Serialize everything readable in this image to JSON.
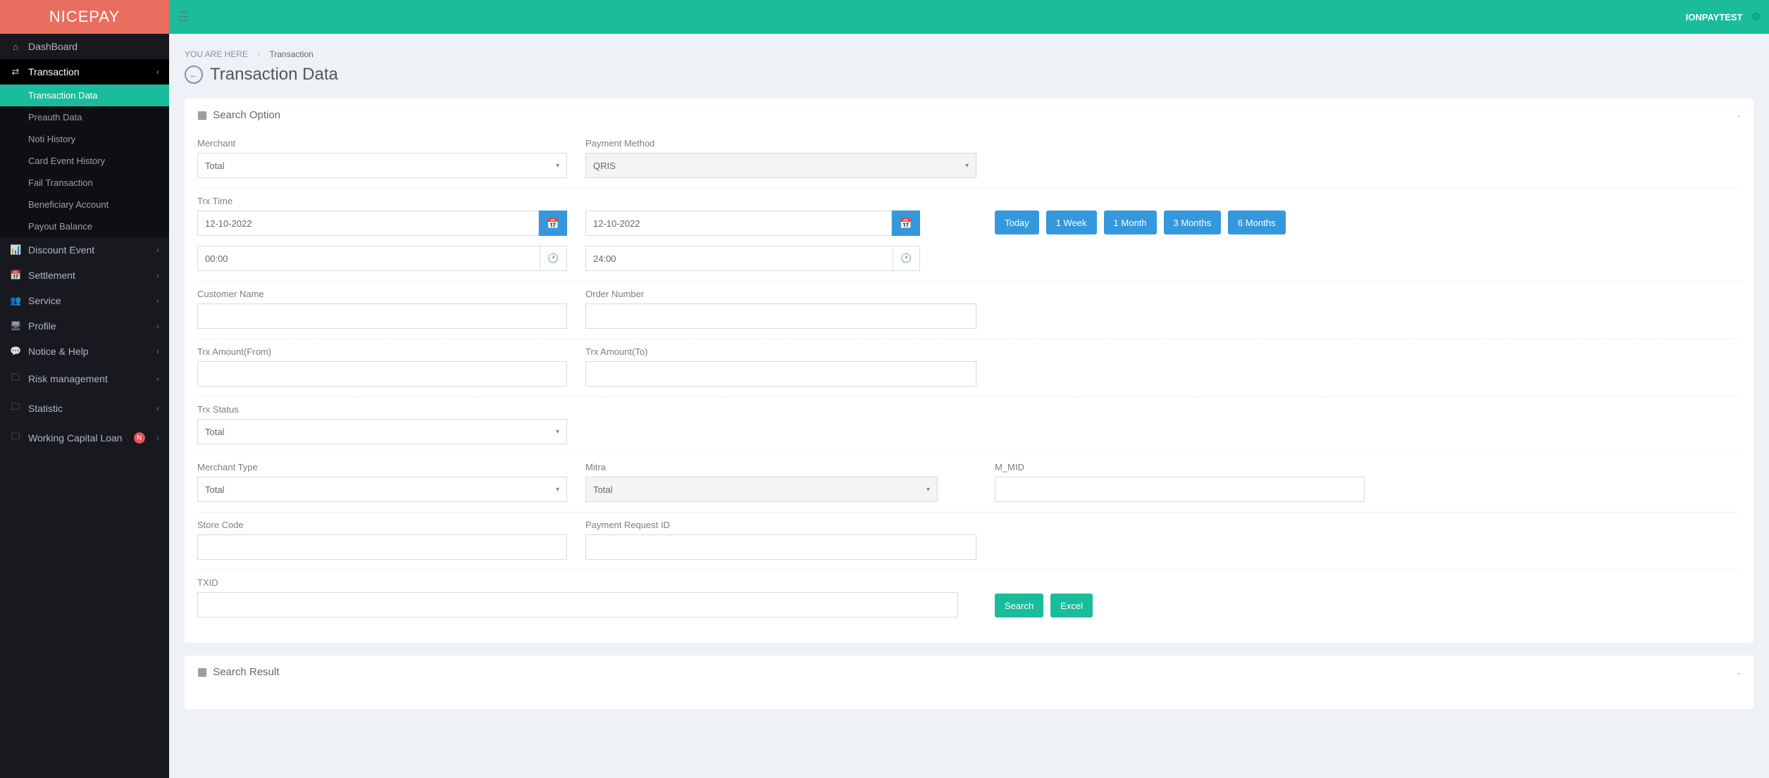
{
  "header": {
    "brand": "NICEPAY",
    "username": "IONPAYTEST"
  },
  "sidebar": {
    "items": [
      {
        "icon": "⌂",
        "label": "DashBoard"
      },
      {
        "icon": "⇄",
        "label": "Transaction",
        "expanded": true,
        "sub": [
          {
            "label": "Transaction Data",
            "active": true
          },
          {
            "label": "Preauth Data"
          },
          {
            "label": "Noti History"
          },
          {
            "label": "Card Event History"
          },
          {
            "label": "Fail Transaction"
          },
          {
            "label": "Beneficiary Account"
          },
          {
            "label": "Payout Balance"
          }
        ]
      },
      {
        "icon": "📊",
        "label": "Discount Event"
      },
      {
        "icon": "📅",
        "label": "Settlement"
      },
      {
        "icon": "👥",
        "label": "Service"
      },
      {
        "icon": "🖥",
        "label": "Profile"
      },
      {
        "icon": "💬",
        "label": "Notice & Help"
      },
      {
        "icon": "🗀",
        "label": "Risk management"
      },
      {
        "icon": "🗀",
        "label": "Statistic"
      },
      {
        "icon": "🗀",
        "label": "Working Capital Loan",
        "badge": "N"
      }
    ]
  },
  "breadcrumb": {
    "root": "YOU ARE HERE",
    "current": "Transaction"
  },
  "page": {
    "title": "Transaction Data"
  },
  "panels": {
    "search_option": "Search Option",
    "search_result": "Search Result"
  },
  "filters": {
    "merchant_label": "Merchant",
    "merchant_value": "Total",
    "payment_method_label": "Payment Method",
    "payment_method_value": "QRIS",
    "trx_time_label": "Trx Time",
    "date_from": "12-10-2022",
    "date_to": "12-10-2022",
    "time_from": "00:00",
    "time_to": "24:00",
    "quick_ranges": [
      "Today",
      "1 Week",
      "1 Month",
      "3 Months",
      "6 Months"
    ],
    "customer_name_label": "Customer Name",
    "customer_name": "",
    "order_number_label": "Order Number",
    "order_number": "",
    "trx_amount_from_label": "Trx Amount(From)",
    "trx_amount_from": "",
    "trx_amount_to_label": "Trx Amount(To)",
    "trx_amount_to": "",
    "trx_status_label": "Trx Status",
    "trx_status_value": "Total",
    "merchant_type_label": "Merchant Type",
    "merchant_type_value": "Total",
    "mitra_label": "Mitra",
    "mitra_value": "Total",
    "m_mid_label": "M_MID",
    "m_mid": "",
    "store_code_label": "Store Code",
    "store_code": "",
    "payment_request_id_label": "Payment Request ID",
    "payment_request_id": "",
    "txid_label": "TXID",
    "txid": ""
  },
  "actions": {
    "search": "Search",
    "excel": "Excel"
  }
}
